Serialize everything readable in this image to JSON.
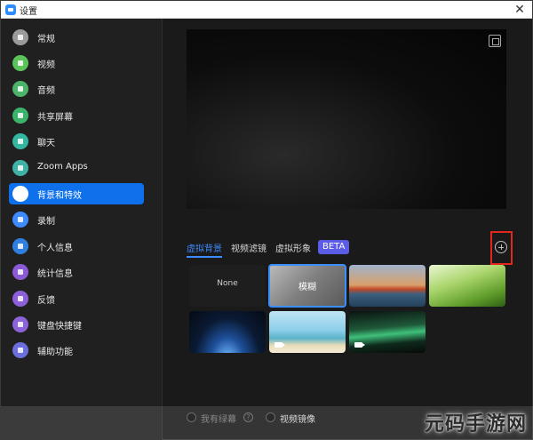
{
  "titlebar": {
    "title": "设置",
    "close": "✕"
  },
  "sidebar": {
    "items": [
      {
        "label": "常规",
        "icon": "gear-icon",
        "color": "#9b9b9b"
      },
      {
        "label": "视频",
        "icon": "video-icon",
        "color": "#5cc35a"
      },
      {
        "label": "音频",
        "icon": "headphones-icon",
        "color": "#4db36a"
      },
      {
        "label": "共享屏幕",
        "icon": "share-screen-icon",
        "color": "#3bb36b"
      },
      {
        "label": "聊天",
        "icon": "chat-icon",
        "color": "#35b6a0"
      },
      {
        "label": "Zoom Apps",
        "icon": "apps-icon",
        "color": "#3fb1a5"
      },
      {
        "label": "背景和特效",
        "icon": "background-icon",
        "color": "#2d8cff",
        "active": true
      },
      {
        "label": "录制",
        "icon": "record-icon",
        "color": "#3d8bff"
      },
      {
        "label": "个人信息",
        "icon": "profile-icon",
        "color": "#2f7fe0"
      },
      {
        "label": "统计信息",
        "icon": "statistics-icon",
        "color": "#8b5bd6"
      },
      {
        "label": "反馈",
        "icon": "feedback-icon",
        "color": "#8d5fd9"
      },
      {
        "label": "键盘快捷键",
        "icon": "keyboard-icon",
        "color": "#8c63d8"
      },
      {
        "label": "辅助功能",
        "icon": "accessibility-icon",
        "color": "#6b6fdb"
      }
    ]
  },
  "tabs": {
    "virtual_background": "虚拟背景",
    "video_filters": "视频滤镜",
    "avatars": "虚拟形象",
    "beta": "BETA"
  },
  "backgrounds": [
    {
      "label": "None"
    },
    {
      "label": "模糊",
      "selected": true
    },
    {
      "label": ""
    },
    {
      "label": ""
    },
    {
      "label": ""
    },
    {
      "label": ""
    },
    {
      "label": ""
    }
  ],
  "options": {
    "green_screen": "我有绿幕",
    "mirror_video": "视频镜像"
  },
  "watermark": "元码手游网"
}
